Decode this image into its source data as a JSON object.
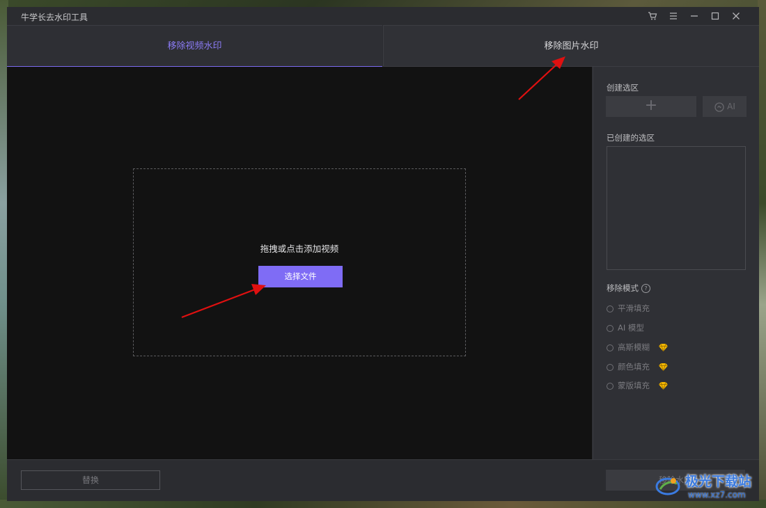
{
  "app": {
    "title": "牛学长去水印工具"
  },
  "window_controls": {
    "cart_icon": "shopping-cart-icon",
    "menu_icon": "hamburger-menu-icon",
    "minimize_icon": "minimize-icon",
    "maximize_icon": "maximize-icon",
    "close_icon": "close-icon"
  },
  "tabs": [
    {
      "label": "移除视频水印",
      "active": true
    },
    {
      "label": "移除图片水印",
      "active": false
    }
  ],
  "canvas": {
    "drop_hint": "拖拽或点击添加视频",
    "choose_button": "选择文件"
  },
  "sidebar": {
    "create_region_label": "创建选区",
    "add_symbol": "+",
    "ai_button": "AI",
    "created_regions_label": "已创建的选区",
    "remove_mode_label": "移除模式",
    "help_symbol": "?",
    "modes": [
      {
        "label": "平滑填充",
        "premium": false
      },
      {
        "label": "AI 模型",
        "premium": false
      },
      {
        "label": "高斯模糊",
        "premium": true
      },
      {
        "label": "颜色填充",
        "premium": true
      },
      {
        "label": "蒙版填充",
        "premium": true
      }
    ]
  },
  "footer": {
    "replace_button": "替换",
    "remove_button": "移除水印"
  },
  "watermark": {
    "name": "极光下载站",
    "url": "www.xz7.com"
  },
  "colors": {
    "accent": "#7f6cf5",
    "window_bg": "#2b2c30",
    "canvas_bg": "#121212",
    "arrow": "#e01010",
    "premium_gem": "#f5b800"
  }
}
